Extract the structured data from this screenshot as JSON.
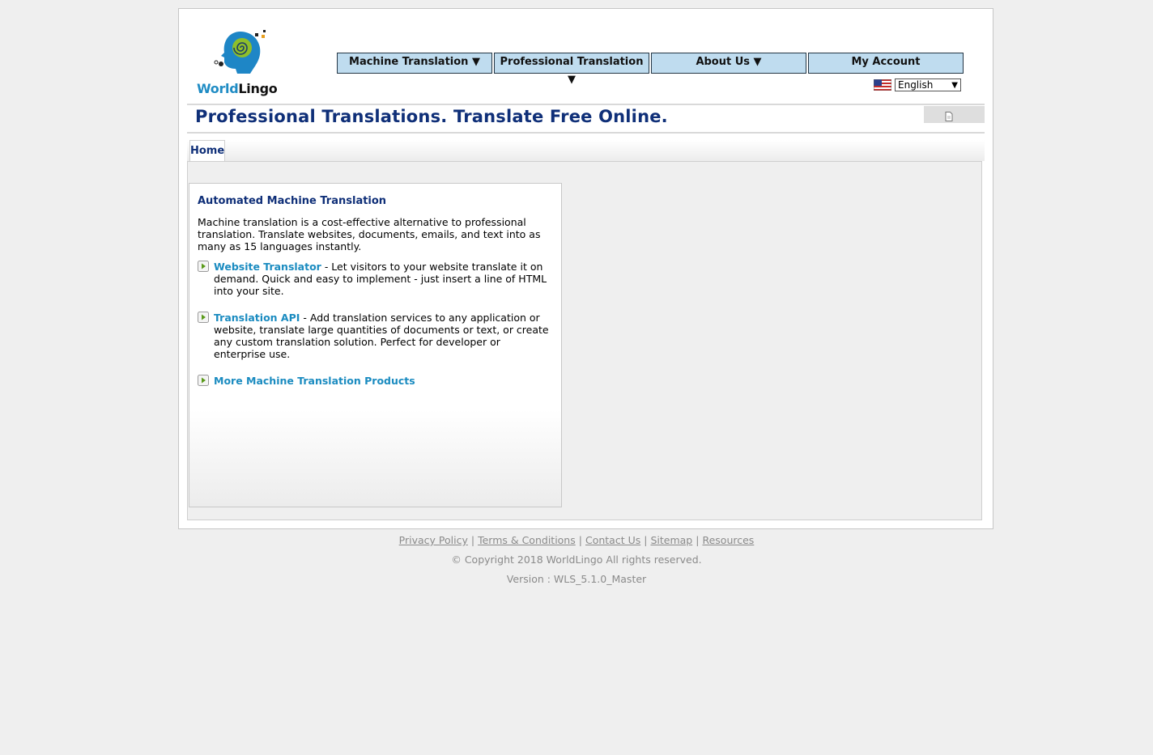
{
  "logo": {
    "world": "World",
    "lingo": "Lingo"
  },
  "nav": [
    {
      "label": "Machine Translation ▼"
    },
    {
      "label": "Professional Translation ▼"
    },
    {
      "label": "About Us ▼"
    },
    {
      "label": "My Account"
    }
  ],
  "language": {
    "selected": "English",
    "flag_icon": "us-flag-icon"
  },
  "page_title": "Professional Translations. Translate Free Online.",
  "tabs": [
    {
      "label": "Home"
    }
  ],
  "box": {
    "heading": "Automated Machine Translation",
    "intro": "Machine translation is a cost-effective alternative to professional translation. Translate websites, documents, emails, and text into as many as 15 languages instantly.",
    "items": [
      {
        "link": "Website Translator",
        "text": " - Let visitors to your website translate it on demand. Quick and easy to implement - just insert a line of HTML into your site."
      },
      {
        "link": "Translation API",
        "text": " - Add translation services to any application or website, translate large quantities of documents or text, or create any custom translation solution. Perfect for developer or enterprise use."
      },
      {
        "link": "More Machine Translation Products",
        "text": ""
      }
    ]
  },
  "footer": {
    "links": [
      "Privacy Policy",
      "Terms & Conditions",
      "Contact Us",
      "Sitemap",
      "Resources"
    ],
    "separator": "|",
    "copyright": "© Copyright 2018 WorldLingo All rights reserved.",
    "version": "Version : WLS_5.1.0_Master"
  },
  "colors": {
    "nav_bg": "#bfdcef",
    "title": "#0f2f78",
    "link": "#1a8bc0",
    "page_bg": "#efefef"
  }
}
